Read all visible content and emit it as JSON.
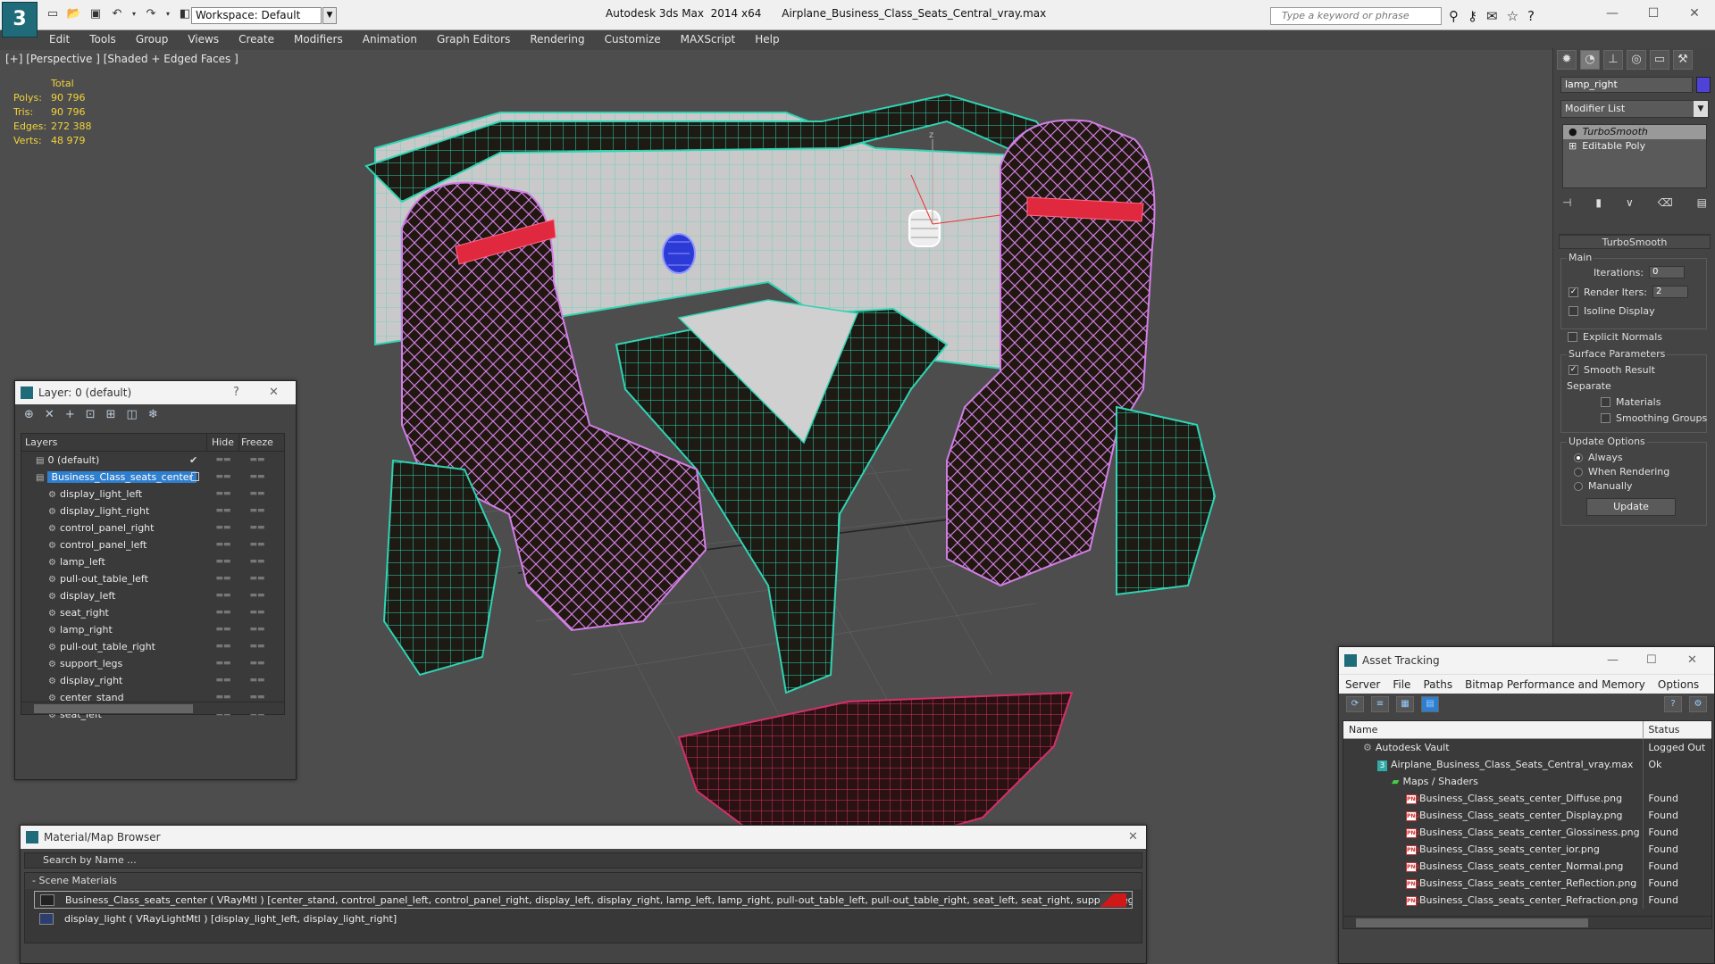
{
  "app": {
    "title": "Autodesk 3ds Max  2014 x64      Airplane_Business_Class_Seats_Central_vray.max",
    "workspace": "Workspace: Default",
    "search_placeholder": "Type a keyword or phrase",
    "logo": "3"
  },
  "menu": [
    "Edit",
    "Tools",
    "Group",
    "Views",
    "Create",
    "Modifiers",
    "Animation",
    "Graph Editors",
    "Rendering",
    "Customize",
    "MAXScript",
    "Help"
  ],
  "viewport": {
    "label": "[+] [Perspective ] [Shaded + Edged Faces ]",
    "stats": {
      "header": "Total",
      "rows": [
        {
          "k": "Polys:",
          "v": "90 796"
        },
        {
          "k": "Tris:",
          "v": "90 796"
        },
        {
          "k": "Edges:",
          "v": "272 388"
        },
        {
          "k": "Verts:",
          "v": "48 979"
        }
      ]
    },
    "gizmo_label": "z"
  },
  "command_panel": {
    "object_name": "lamp_right",
    "object_color": "#4f42d8",
    "modifier_list": "Modifier List",
    "stack": [
      "TurboSmooth",
      "Editable Poly"
    ],
    "rollout_title": "TurboSmooth",
    "main_group": "Main",
    "iterations_label": "Iterations:",
    "iterations_value": "0",
    "render_iters_label": "Render Iters:",
    "render_iters_value": "2",
    "isoline": "Isoline Display",
    "explicit": "Explicit Normals",
    "surface_group": "Surface Parameters",
    "smooth_result": "Smooth Result",
    "separate": "Separate",
    "materials": "Materials",
    "smoothing_groups": "Smoothing Groups",
    "update_group": "Update Options",
    "always": "Always",
    "when_rendering": "When Rendering",
    "manually": "Manually",
    "update_button": "Update"
  },
  "layer_dialog": {
    "title": "Layer: 0 (default)",
    "help": "?",
    "col_layers": "Layers",
    "col_hide": "Hide",
    "col_freeze": "Freeze",
    "rows": [
      {
        "name": "0 (default)",
        "level": 1,
        "check": "✔"
      },
      {
        "name": "Business_Class_seats_center",
        "level": 1,
        "selected": true
      },
      {
        "name": "display_light_left",
        "level": 2
      },
      {
        "name": "display_light_right",
        "level": 2
      },
      {
        "name": "control_panel_right",
        "level": 2
      },
      {
        "name": "control_panel_left",
        "level": 2
      },
      {
        "name": "lamp_left",
        "level": 2
      },
      {
        "name": "pull-out_table_left",
        "level": 2
      },
      {
        "name": "display_left",
        "level": 2
      },
      {
        "name": "seat_right",
        "level": 2
      },
      {
        "name": "lamp_right",
        "level": 2
      },
      {
        "name": "pull-out_table_right",
        "level": 2
      },
      {
        "name": "support_legs",
        "level": 2
      },
      {
        "name": "display_right",
        "level": 2
      },
      {
        "name": "center_stand",
        "level": 2
      },
      {
        "name": "seat_left",
        "level": 2
      }
    ]
  },
  "material_browser": {
    "title": "Material/Map Browser",
    "search": "Search by Name ...",
    "section": "- Scene Materials",
    "items": [
      "Business_Class_seats_center ( VRayMtl ) [center_stand, control_panel_left, control_panel_right, display_left, display_right, lamp_left, lamp_right, pull-out_table_left, pull-out_table_right, seat_left, seat_right, support_legs]",
      "display_light ( VRayLightMtl ) [display_light_left, display_light_right]"
    ]
  },
  "asset_tracking": {
    "title": "Asset Tracking",
    "menu": [
      "Server",
      "File",
      "Paths",
      "Bitmap Performance and Memory",
      "Options"
    ],
    "col_name": "Name",
    "col_status": "Status",
    "rows": [
      {
        "name": "Autodesk Vault",
        "status": "Logged Out",
        "indent": 1,
        "icon": "vault"
      },
      {
        "name": "Airplane_Business_Class_Seats_Central_vray.max",
        "status": "Ok",
        "indent": 2,
        "icon": "max"
      },
      {
        "name": "Maps / Shaders",
        "status": "",
        "indent": 3,
        "icon": "maps"
      },
      {
        "name": "Business_Class_seats_center_Diffuse.png",
        "status": "Found",
        "indent": 4,
        "icon": "png"
      },
      {
        "name": "Business_Class_seats_center_Display.png",
        "status": "Found",
        "indent": 4,
        "icon": "png"
      },
      {
        "name": "Business_Class_seats_center_Glossiness.png",
        "status": "Found",
        "indent": 4,
        "icon": "png"
      },
      {
        "name": "Business_Class_seats_center_ior.png",
        "status": "Found",
        "indent": 4,
        "icon": "png"
      },
      {
        "name": "Business_Class_seats_center_Normal.png",
        "status": "Found",
        "indent": 4,
        "icon": "png"
      },
      {
        "name": "Business_Class_seats_center_Reflection.png",
        "status": "Found",
        "indent": 4,
        "icon": "png"
      },
      {
        "name": "Business_Class_seats_center_Refraction.png",
        "status": "Found",
        "indent": 4,
        "icon": "png"
      }
    ]
  }
}
